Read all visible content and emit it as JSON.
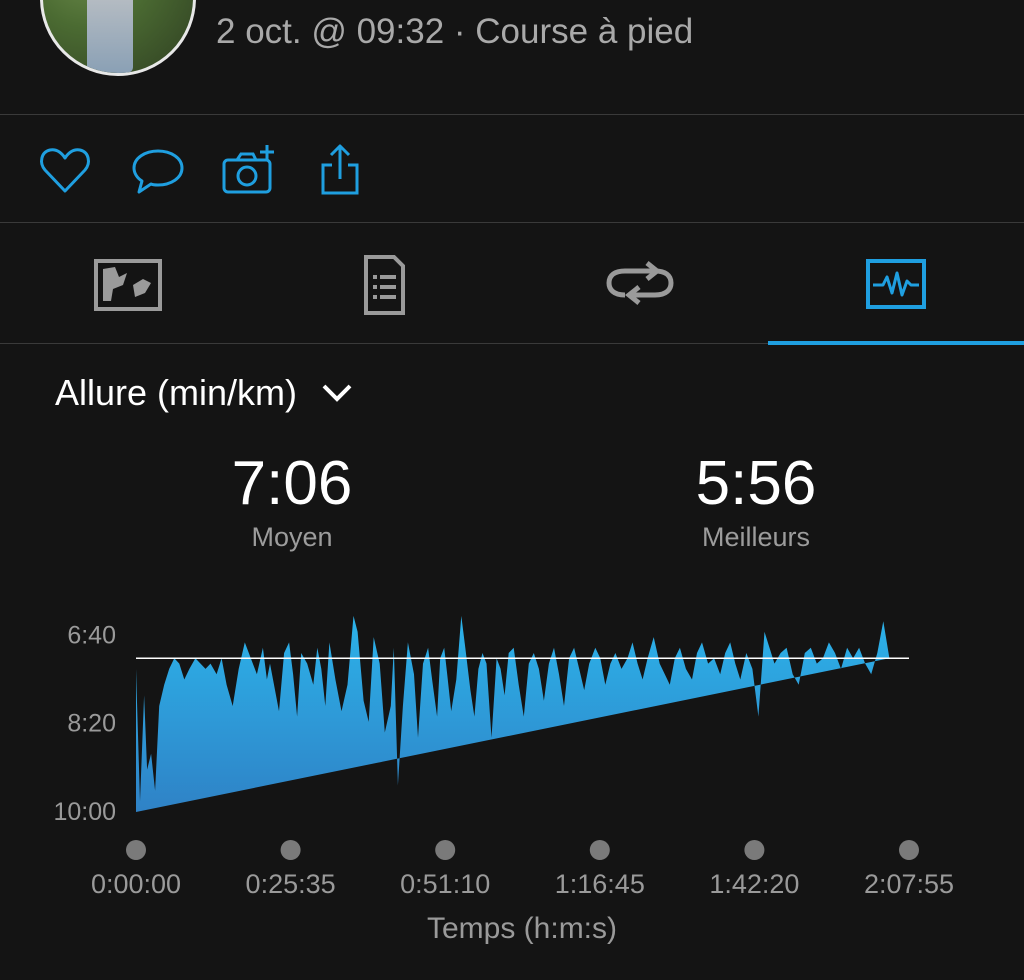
{
  "header": {
    "subtitle": "2 oct. @ 09:32 · Course à pied"
  },
  "actions": [
    {
      "icon": "heart-icon"
    },
    {
      "icon": "comment-icon"
    },
    {
      "icon": "add-photo-icon"
    },
    {
      "icon": "share-icon"
    }
  ],
  "tabs": [
    {
      "icon": "map-icon",
      "active": false
    },
    {
      "icon": "details-list-icon",
      "active": false
    },
    {
      "icon": "laps-icon",
      "active": false
    },
    {
      "icon": "charts-icon",
      "active": true
    }
  ],
  "metric": {
    "label": "Allure (min/km)"
  },
  "stats": {
    "average": {
      "value": "7:06",
      "label": "Moyen"
    },
    "best": {
      "value": "5:56",
      "label": "Meilleurs"
    }
  },
  "colors": {
    "accent": "#1f9fe0",
    "area_top": "#2cb3ea",
    "area_bottom": "#2f82c6"
  },
  "chart_data": {
    "type": "area",
    "ylabel": "",
    "xlabel": "Temps (h:m:s)",
    "y_ticks": [
      "6:40",
      "8:20",
      "10:00"
    ],
    "y_ticks_min": [
      6.667,
      8.333,
      10.0
    ],
    "x_ticks": [
      "0:00:00",
      "0:25:35",
      "0:51:10",
      "1:16:45",
      "1:42:20",
      "2:07:55"
    ],
    "x_ticks_sec": [
      0,
      1535,
      3070,
      4605,
      6140,
      7675
    ],
    "ylim": [
      10.0,
      6.0
    ],
    "y_inverted": true,
    "xlim_sec": [
      0,
      7675
    ],
    "reference_line_min": 7.1,
    "series": [
      {
        "x_sec": [
          0,
          40,
          80,
          110,
          150,
          190,
          230,
          280,
          330,
          380,
          430,
          480,
          530,
          590,
          640,
          690,
          740,
          800,
          850,
          900,
          960,
          1020,
          1080,
          1140,
          1200,
          1260,
          1300,
          1330,
          1370,
          1420,
          1470,
          1520,
          1560,
          1600,
          1640,
          1700,
          1760,
          1800,
          1840,
          1880,
          1920,
          1980,
          2040,
          2100,
          2160,
          2200,
          2260,
          2310,
          2360,
          2420,
          2470,
          2530,
          2560,
          2600,
          2650,
          2700,
          2760,
          2800,
          2850,
          2900,
          2940,
          2990,
          3020,
          3060,
          3090,
          3130,
          3180,
          3230,
          3270,
          3320,
          3360,
          3400,
          3440,
          3480,
          3530,
          3580,
          3620,
          3660,
          3700,
          3750,
          3800,
          3850,
          3900,
          3950,
          4000,
          4050,
          4100,
          4150,
          4200,
          4250,
          4300,
          4350,
          4400,
          4450,
          4500,
          4560,
          4610,
          4660,
          4710,
          4760,
          4820,
          4880,
          4930,
          4980,
          5030,
          5080,
          5140,
          5200,
          5250,
          5300,
          5350,
          5400,
          5460,
          5520,
          5570,
          5620,
          5680,
          5740,
          5800,
          5850,
          5900,
          5950,
          6000,
          6060,
          6120,
          6180,
          6240,
          6290,
          6340,
          6400,
          6460,
          6520,
          6580,
          6640,
          6700,
          6760,
          6820,
          6880,
          6940,
          7000,
          7060,
          7120,
          7180,
          7240,
          7300,
          7360,
          7420,
          7480,
          7540,
          7600,
          7640,
          7675
        ],
        "y_min": [
          7.3,
          9.8,
          7.8,
          9.2,
          8.9,
          9.6,
          8.0,
          7.6,
          7.3,
          7.1,
          7.2,
          7.5,
          7.3,
          7.1,
          7.2,
          7.3,
          7.2,
          7.4,
          7.1,
          7.6,
          8.0,
          7.3,
          6.8,
          7.1,
          7.4,
          6.9,
          7.5,
          7.2,
          7.6,
          8.1,
          7.0,
          6.8,
          7.4,
          8.2,
          7.0,
          7.2,
          7.6,
          6.9,
          7.3,
          8.0,
          6.8,
          7.5,
          8.1,
          7.6,
          6.3,
          6.6,
          7.9,
          8.3,
          6.7,
          7.2,
          8.5,
          8.0,
          6.9,
          9.5,
          8.0,
          6.8,
          7.4,
          8.6,
          7.2,
          6.9,
          7.5,
          8.2,
          7.1,
          6.9,
          7.4,
          8.1,
          7.5,
          6.3,
          6.9,
          7.7,
          8.2,
          7.3,
          7.0,
          7.2,
          8.6,
          7.1,
          7.3,
          7.8,
          7.0,
          6.9,
          7.6,
          8.2,
          7.2,
          7.0,
          7.3,
          7.9,
          7.2,
          6.9,
          7.4,
          8.0,
          7.1,
          6.9,
          7.3,
          7.7,
          7.2,
          6.9,
          7.1,
          7.6,
          7.2,
          7.0,
          7.3,
          7.1,
          6.8,
          7.2,
          7.5,
          7.1,
          6.7,
          7.2,
          7.4,
          7.6,
          7.1,
          6.9,
          7.3,
          7.5,
          7.0,
          6.8,
          7.2,
          7.1,
          7.4,
          7.0,
          6.8,
          7.2,
          7.5,
          7.0,
          7.3,
          8.2,
          6.6,
          6.9,
          7.2,
          7.0,
          6.9,
          7.4,
          7.6,
          7.0,
          6.9,
          7.2,
          7.1,
          6.8,
          7.0,
          7.3,
          6.9,
          7.1,
          6.9,
          7.2,
          7.4,
          7.0,
          6.4,
          7.1
        ]
      }
    ]
  }
}
